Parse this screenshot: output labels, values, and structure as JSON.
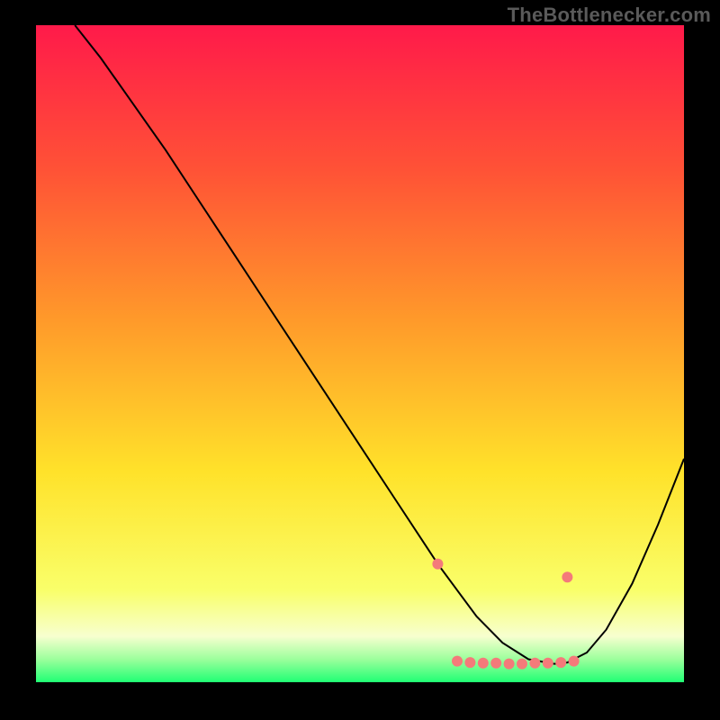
{
  "attribution": "TheBottlenecker.com",
  "chart_data": {
    "type": "line",
    "title": "",
    "xlabel": "",
    "ylabel": "",
    "xlim": [
      0,
      100
    ],
    "ylim": [
      0,
      100
    ],
    "grid": false,
    "background_gradient": {
      "top": "#ff1a4a",
      "mid_upper": "#ff7a2f",
      "mid_lower": "#ffe22a",
      "bottom_band": "#f7ffcf",
      "base": "#20ff74"
    },
    "series": [
      {
        "name": "curve",
        "color": "#000000",
        "stroke_width": 2,
        "x": [
          6,
          10,
          15,
          20,
          25,
          30,
          35,
          40,
          45,
          50,
          55,
          60,
          62,
          65,
          68,
          72,
          76,
          80,
          82,
          85,
          88,
          92,
          96,
          100
        ],
        "y": [
          100,
          95,
          88,
          81,
          73.5,
          66,
          58.5,
          51,
          43.5,
          36,
          28.5,
          21,
          18,
          14,
          10,
          6,
          3.5,
          2.8,
          3,
          4.5,
          8,
          15,
          24,
          34
        ]
      }
    ],
    "scatter": {
      "name": "markers",
      "color": "#f47a7a",
      "radius": 6,
      "x": [
        62,
        65,
        67,
        69,
        71,
        73,
        75,
        77,
        79,
        81,
        82,
        83
      ],
      "y": [
        18,
        3.2,
        3,
        2.9,
        2.9,
        2.8,
        2.8,
        2.9,
        2.9,
        3,
        16,
        3.2
      ]
    }
  }
}
